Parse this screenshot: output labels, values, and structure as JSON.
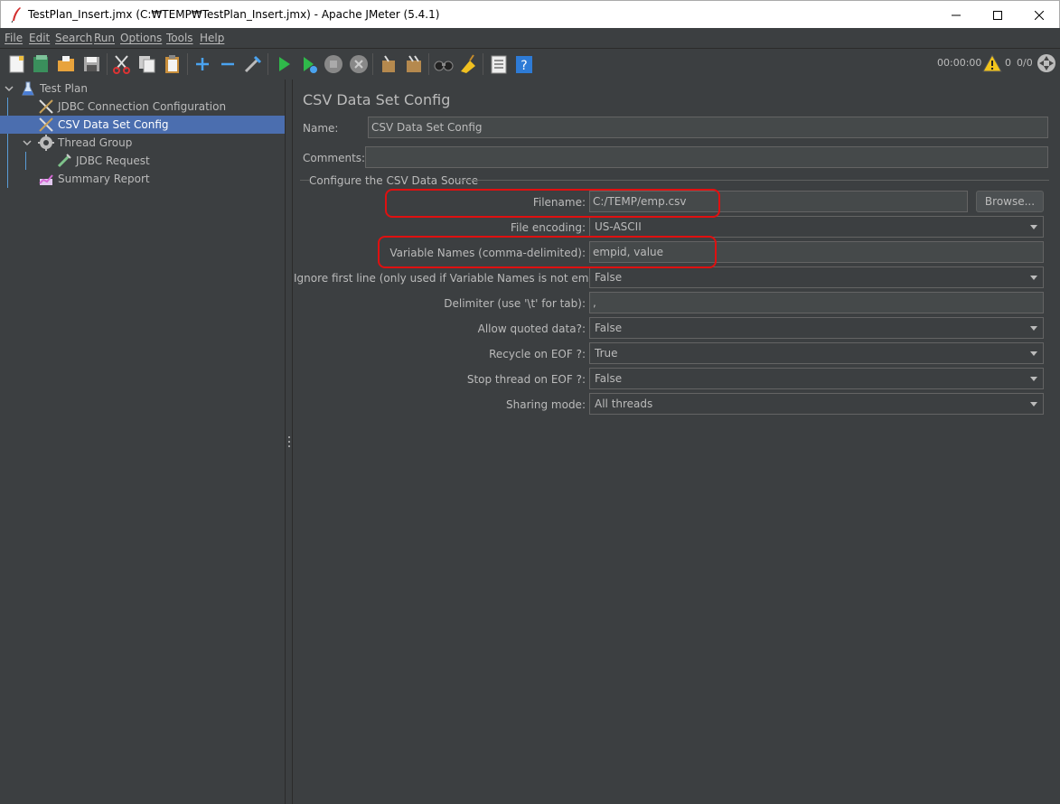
{
  "window": {
    "title": "TestPlan_Insert.jmx (C:₩TEMP₩TestPlan_Insert.jmx) - Apache JMeter (5.4.1)"
  },
  "menu": [
    "File",
    "Edit",
    "Search",
    "Run",
    "Options",
    "Tools",
    "Help"
  ],
  "toolbar": {
    "icons": [
      "new-icon",
      "templates-icon",
      "open-icon",
      "save-icon",
      "cut-icon",
      "copy-icon",
      "paste-icon",
      "expand-icon",
      "collapse-icon",
      "toggle-icon",
      "start-icon",
      "start-no-pauses-icon",
      "stop-icon",
      "shutdown-icon",
      "clear-icon",
      "clear-all-icon",
      "search-icon",
      "reset-search-icon",
      "function-helper-icon",
      "help-icon"
    ],
    "elapsed": "00:00:00",
    "warnings": "0",
    "threads": "0/0"
  },
  "tree": {
    "items": [
      {
        "label": "Test Plan",
        "icon": "test-plan-icon"
      },
      {
        "label": "JDBC Connection Configuration",
        "icon": "config-icon"
      },
      {
        "label": "CSV Data Set Config",
        "icon": "config-icon"
      },
      {
        "label": "Thread Group",
        "icon": "gear-icon"
      },
      {
        "label": "JDBC Request",
        "icon": "sampler-icon"
      },
      {
        "label": "Summary Report",
        "icon": "report-icon"
      }
    ]
  },
  "panel": {
    "title": "CSV Data Set Config",
    "name_label": "Name:",
    "name_value": "CSV Data Set Config",
    "comments_label": "Comments:",
    "comments_value": "",
    "group_title": "Configure the CSV Data Source",
    "filename_label": "Filename:",
    "filename_value": "C:/TEMP/emp.csv",
    "browse_label": "Browse...",
    "encoding_label": "File encoding:",
    "encoding_value": "US-ASCII",
    "varnames_label": "Variable Names (comma-delimited):",
    "varnames_value": "empid, value",
    "ignore_label": "Ignore first line (only used if Variable Names is not empty):",
    "ignore_value": "False",
    "delimiter_label": "Delimiter (use '\\t' for tab):",
    "delimiter_value": ",",
    "quoted_label": "Allow quoted data?:",
    "quoted_value": "False",
    "recycle_label": "Recycle on EOF ?:",
    "recycle_value": "True",
    "stopthread_label": "Stop thread on EOF ?:",
    "stopthread_value": "False",
    "sharing_label": "Sharing mode:",
    "sharing_value": "All threads"
  },
  "colors": {
    "background": "#3c3f41",
    "selection": "#4b6eaf",
    "highlight": "#e01010"
  }
}
